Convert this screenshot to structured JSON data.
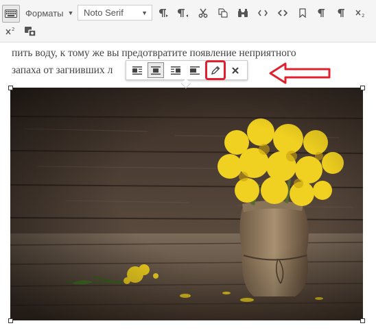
{
  "toolbar": {
    "formats_label": "Форматы",
    "font_family_value": "Noto Serif",
    "icons": [
      "keyboard-icon",
      "formats-dropdown",
      "font-select",
      "paragraph-ltr-icon",
      "paragraph-rtl-icon",
      "cut-icon",
      "copy-icon",
      "find-icon",
      "code-icon",
      "source-code-icon",
      "bookmark-icon",
      "show-blocks-icon",
      "pilcrow-icon",
      "subscript-icon",
      "superscript-icon",
      "preview-icon"
    ]
  },
  "content": {
    "line1": "пить воду, к тому же вы предотвратите появление неприятного",
    "line2": "запаха от загнивших л",
    "image_description_alt": "Желтые цветы в мешковине на деревянном столе"
  },
  "inline_toolbar": {
    "buttons": [
      "align-left",
      "align-center",
      "align-right",
      "no-align",
      "edit",
      "remove"
    ],
    "active": "align-center"
  },
  "colors": {
    "accent_red": "#e0202c",
    "toolbar_bg": "#f5f5f5",
    "icon": "#555555"
  }
}
